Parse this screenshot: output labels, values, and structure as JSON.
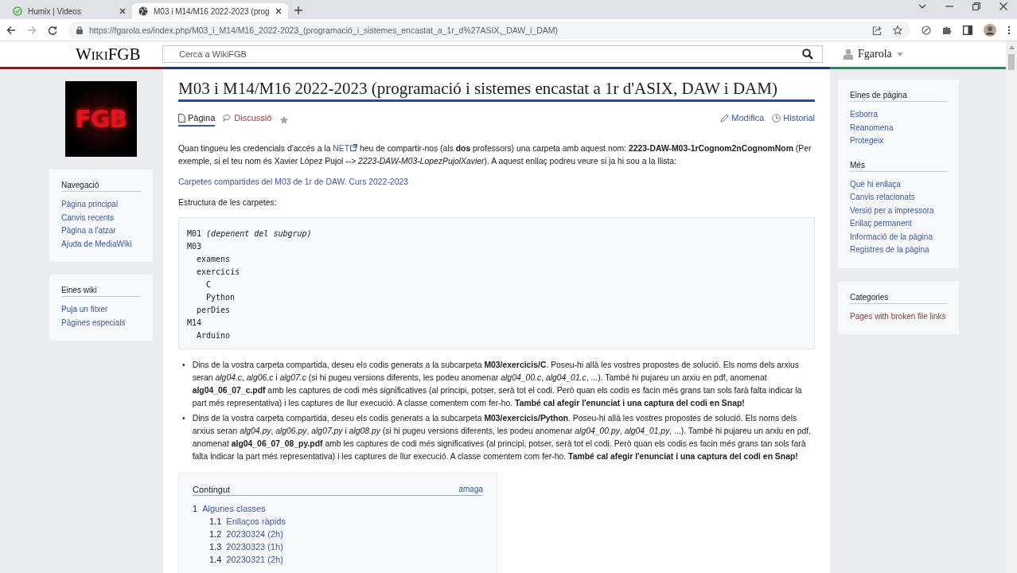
{
  "browser": {
    "tabs": [
      {
        "title": "Humix | Videos",
        "selected": false,
        "kind": "app"
      },
      {
        "title": "M03 i M14/M16 2022-2023 (prog",
        "selected": true,
        "kind": "globe"
      }
    ],
    "url": "https://fgarola.es/index.php/M03_i_M14/M16_2022-2023_(programació_i_sistemes_encastat_a_1r_d%27ASIX,_DAW_i_DAM)"
  },
  "header": {
    "wordmark": "WikiFGB",
    "search": {
      "placeholder": "Cerca a WikiFGB"
    },
    "user": "Fgarola"
  },
  "logo": "FGB",
  "left_sidebar": [
    {
      "heading": "Navegació",
      "items": [
        "Pàgina principal",
        "Canvis recents",
        "Pàgina a l'atzar",
        "Ajuda de MediaWiki"
      ]
    },
    {
      "heading": "Eines wiki",
      "items": [
        "Puja un fitxer",
        "Pàgines especials"
      ]
    }
  ],
  "page": {
    "title": "M03 i M14/M16 2022-2023 (programació i sistemes encastat a 1r d'ASIX, DAW i DAM)",
    "tabs": [
      {
        "label": "Pàgina",
        "selected": true,
        "kind": "page",
        "missing": false
      },
      {
        "label": "Discussió",
        "selected": false,
        "kind": "talk",
        "missing": true
      }
    ],
    "actions": [
      {
        "label": "Modifica",
        "kind": "edit"
      },
      {
        "label": "Historial",
        "kind": "history"
      }
    ],
    "content": [
      {
        "kind": "para",
        "parts": [
          {
            "kind": "text",
            "text": "Quan tingueu les credencials d'accés a la "
          },
          {
            "kind": "link",
            "text": "NET",
            "external": true
          },
          {
            "kind": "text",
            "text": " heu de compartir-nos (als **dos** professors) una carpeta amb aquest nom: **2223-DAW-M03-1rCognom2nCognomNom** (Per exemple, si el teu nom és Xavier López Pujol --> *2223-DAW-M03-LopezPujolXavier*). A aquest enllaç podreu veure si ja hi sou a la llista:"
          }
        ]
      },
      {
        "kind": "link",
        "text": "Carpetes compartides del M03 de 1r de DAW. Curs 2022-2023"
      },
      {
        "kind": "para",
        "parts": [
          {
            "kind": "text",
            "text": "Estructura de les carpetes:"
          }
        ]
      },
      {
        "kind": "code",
        "tree": [
          {
            "text": "M01 *(depenent del subgrup)*"
          },
          {
            "text": "M03",
            "children": [
              {
                "text": "examens"
              },
              {
                "text": "exercicis",
                "children": [
                  {
                    "text": "C"
                  },
                  {
                    "text": "Python"
                  }
                ]
              },
              {
                "text": "perDies"
              }
            ]
          },
          {
            "text": "M14",
            "children": [
              {
                "text": "Arduino"
              }
            ]
          }
        ]
      },
      {
        "kind": "bullets",
        "items": [
          {
            "bullet": "•",
            "text": "Dins de la vostra carpeta compartida, deseu els codis generats a la subcarpeta **M03/exercicis/C**. Poseu-hi allà les vostres propostes de solució. Els noms dels arxius seran *alg04.c*, *alg06.c* i *alg07.c* (si hi pugeu versions diferents, les podeu anomenar *alg04_00.c*, *alg04_01.c*, ...). També hi pujareu un arxiu en pdf, anomenat **alg04_06_07_c.pdf** amb les captures de codi més significatives (al principi, potser, serà tot el codi. Però quan els codis es facin més grans tan sols farà falta indicar la part més representativa) i les captures de llur execució. A classe comentem com fer-ho. **També cal afegir l'enunciat i una captura del codi en Snap!**"
          },
          {
            "bullet": "•",
            "text": "Dins de la vostra carpeta compartida, deseu els codis generats a la subcarpeta **M03/exercicis/Python**. Poseu-hi allà les vostres propostes de solució. Els noms dels arxius seran *alg04.py*, *alg06.py*, *alg07.py* i *alg08.py* (si hi pugeu versions diferents, les podeu anomenar *alg04_00.py*, *alg04_01.py*, ...). També hi pujareu un arxiu en pdf, anomenat **alg04_06_07_08_py.pdf** amb les captures de codi més significatives (al principi, potser, serà tot el codi. Però quan els codis es facin més grans tan sols farà falta indicar la part més representativa) i les captures de llur execució. A classe comentem com fer-ho. **També cal afegir l'enunciat i una captura del codi en Snap!**"
          }
        ]
      },
      {
        "kind": "toc",
        "title": "Contingut",
        "toggle": "amaga",
        "items": [
          {
            "number": "1",
            "text": "Algunes classes",
            "children": [
              {
                "number": "1.1",
                "text": "Enllaços ràpids"
              },
              {
                "number": "1.2",
                "text": "20230324 (2h)"
              },
              {
                "number": "1.3",
                "text": "20230323 (1h)"
              },
              {
                "number": "1.4",
                "text": "20230321 (2h)"
              }
            ]
          }
        ]
      }
    ]
  },
  "right_sidebar": [
    {
      "heading": "Eines de pàgina",
      "items": [
        {
          "label": "Esborra",
          "missing": false
        },
        {
          "label": "Reanomena",
          "missing": false
        },
        {
          "label": "Protegeix",
          "missing": false
        }
      ]
    },
    {
      "heading": "Més",
      "items": [
        {
          "label": "Què hi enllaça",
          "missing": false
        },
        {
          "label": "Canvis relacionats",
          "missing": false
        },
        {
          "label": "Versió per a impressora",
          "missing": false
        },
        {
          "label": "Enllaç permanent",
          "missing": false
        },
        {
          "label": "Informació de la pàgina",
          "missing": false
        },
        {
          "label": "Registres de la pàgina",
          "missing": false
        }
      ]
    },
    {
      "heading": "Categories",
      "items": [
        {
          "label": "Pages with broken file links",
          "missing": true
        }
      ]
    }
  ]
}
